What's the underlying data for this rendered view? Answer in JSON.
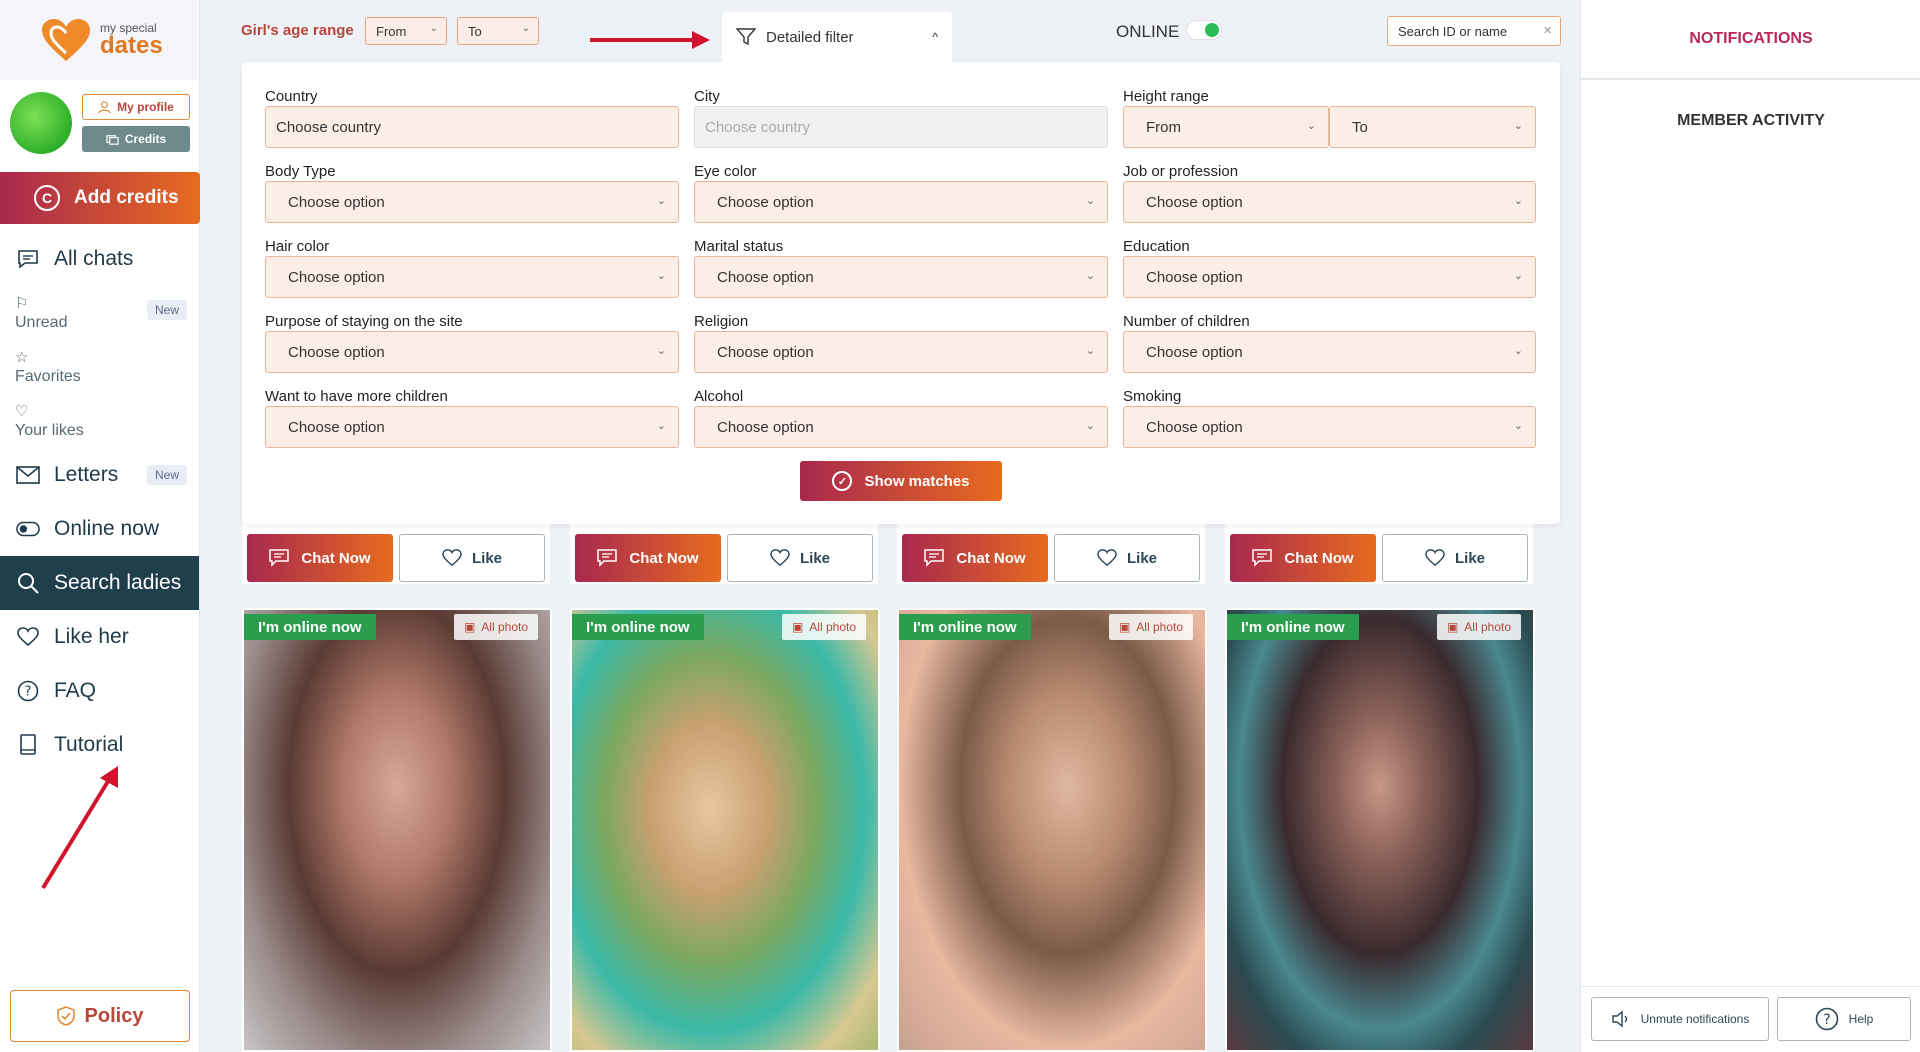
{
  "logo": {
    "small": "my special",
    "big": "dates"
  },
  "profile": {
    "my_profile": "My profile",
    "credits": "Credits"
  },
  "add_credits": "Add credits",
  "nav": {
    "all_chats": "All chats",
    "unread": "Unread",
    "unread_badge": "New",
    "favorites": "Favorites",
    "your_likes": "Your likes",
    "letters": "Letters",
    "letters_badge": "New",
    "online_now": "Online now",
    "search_ladies": "Search ladies",
    "like_her": "Like her",
    "faq": "FAQ",
    "tutorial": "Tutorial",
    "policy": "Policy"
  },
  "topbar": {
    "age_label": "Girl's age range",
    "from": "From",
    "to": "To",
    "detailed_filter": "Detailed filter",
    "online": "ONLINE",
    "search_placeholder": "Search ID or name"
  },
  "filter": {
    "country_label": "Country",
    "country_value": "Choose country",
    "city_label": "City",
    "city_value": "Choose country",
    "height_label": "Height range",
    "height_from": "From",
    "height_to": "To",
    "body_type_label": "Body Type",
    "eye_color_label": "Eye color",
    "job_label": "Job or profession",
    "hair_color_label": "Hair color",
    "marital_label": "Marital status",
    "education_label": "Education",
    "purpose_label": "Purpose of staying on the site",
    "religion_label": "Religion",
    "children_label": "Number of children",
    "more_children_label": "Want to have more children",
    "alcohol_label": "Alcohol",
    "smoking_label": "Smoking",
    "option_placeholder": "Choose option",
    "show_matches": "Show matches"
  },
  "cards": {
    "chat_now": "Chat Now",
    "like": "Like",
    "online_badge": "I'm online now",
    "all_photo": "All photo"
  },
  "right": {
    "notifications": "NOTIFICATIONS",
    "member_activity": "MEMBER ACTIVITY",
    "unmute": "Unmute notifications",
    "help": "Help"
  },
  "colors": {
    "accent_start": "#a8284e",
    "accent_end": "#e76b1f",
    "nav_active": "#1f3f4b",
    "online_green": "#2b9e4d"
  }
}
